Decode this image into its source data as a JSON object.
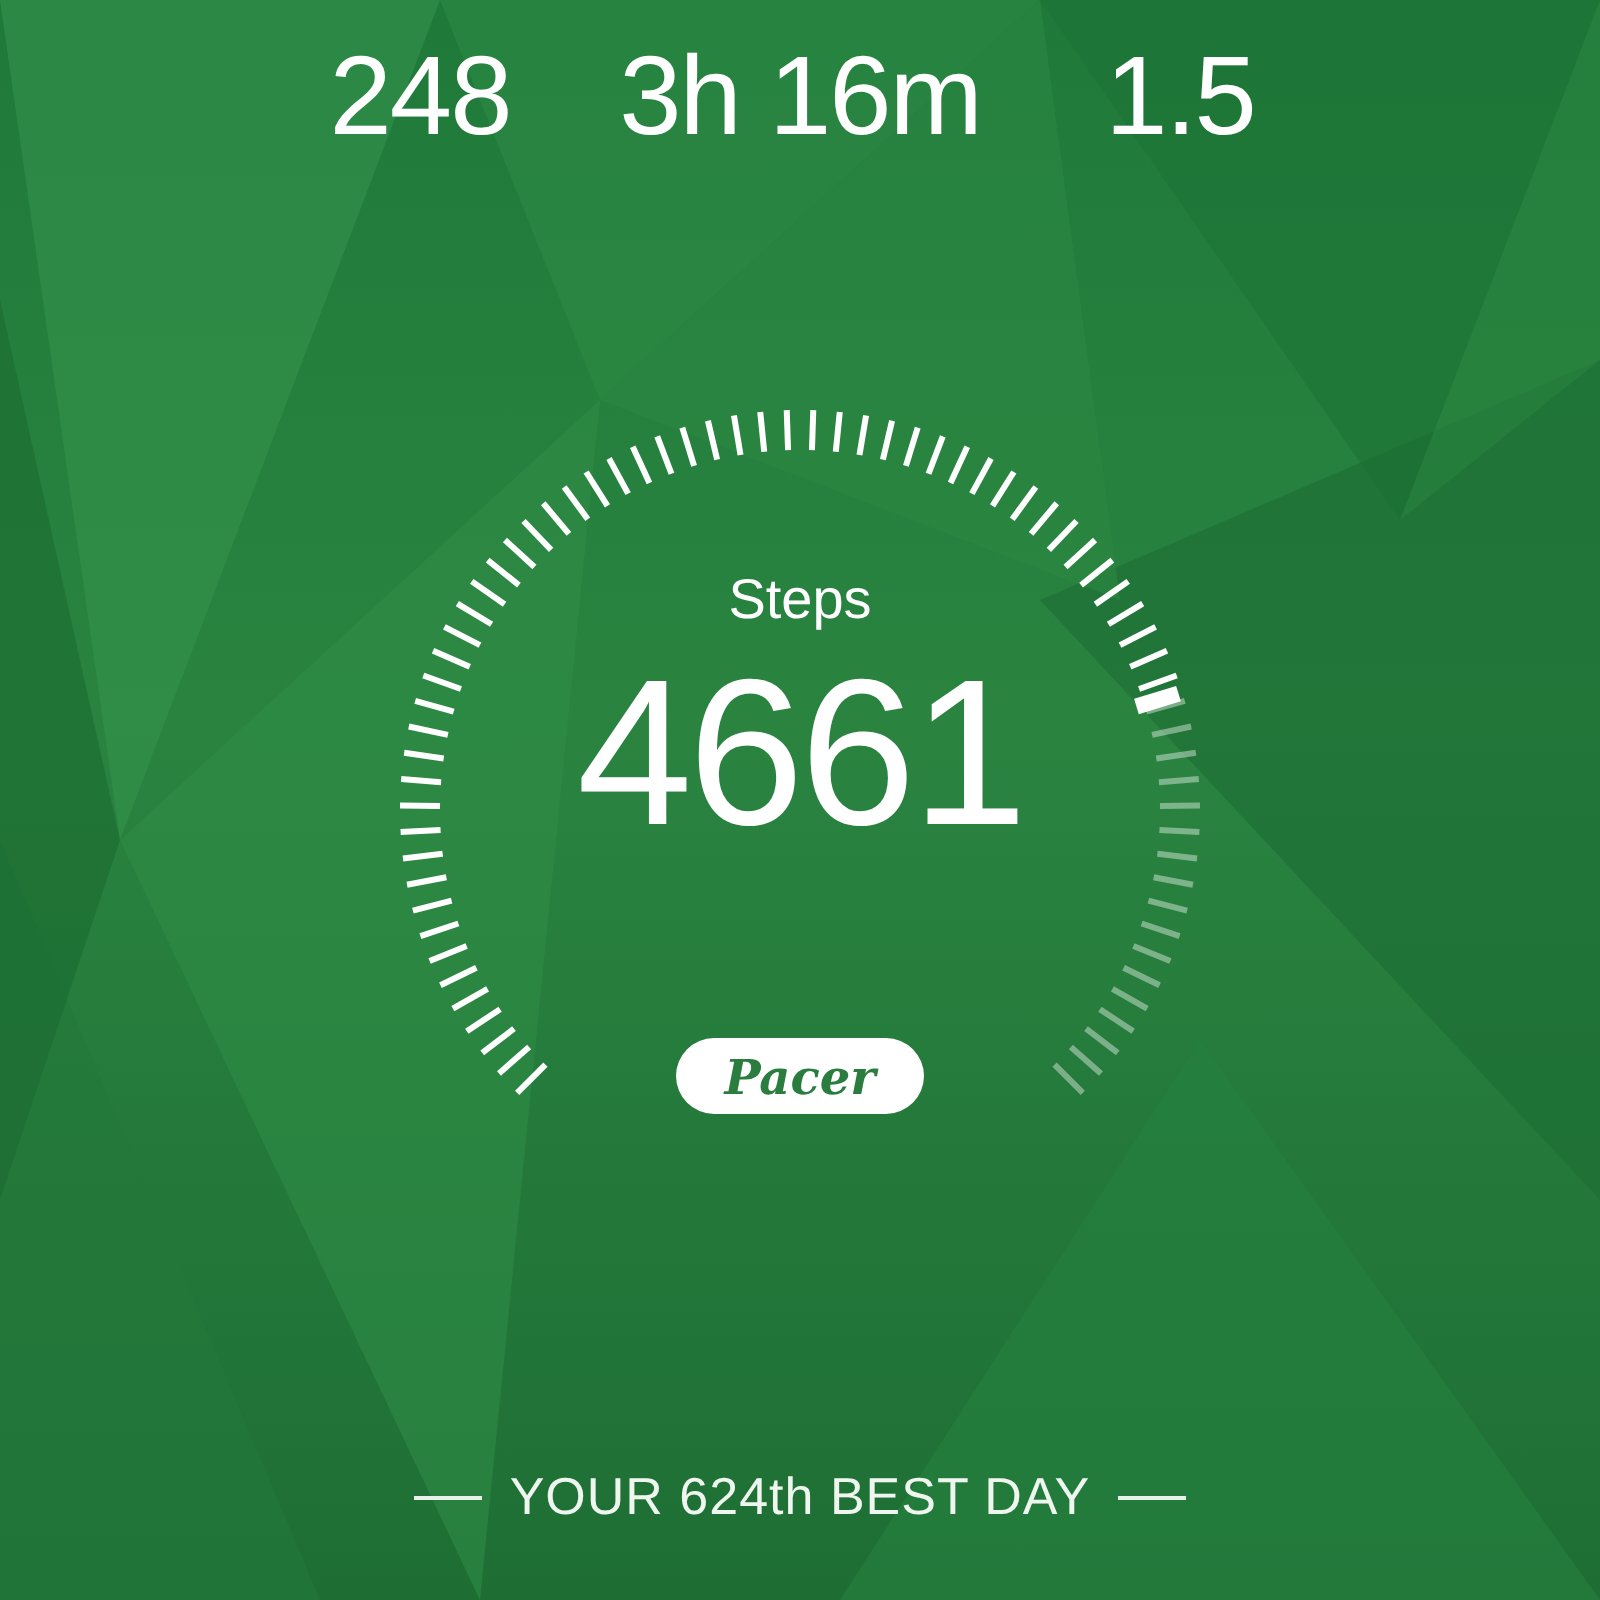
{
  "stats": [
    {
      "value": "248"
    },
    {
      "value": "3h 16m"
    },
    {
      "value": "1.5"
    }
  ],
  "gauge": {
    "label": "Steps",
    "value": "4661"
  },
  "brand": "Pacer",
  "rank": "YOUR 624th BEST DAY"
}
